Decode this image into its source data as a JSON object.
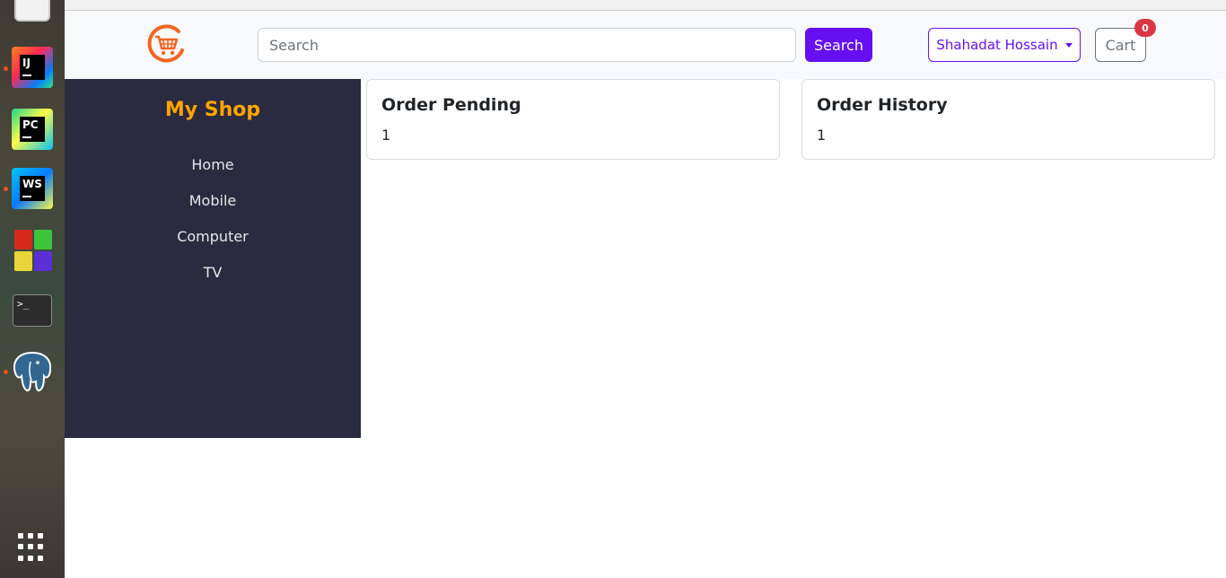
{
  "dock": {
    "items": [
      {
        "name": "intellij-idea",
        "label": "IJ"
      },
      {
        "name": "pycharm",
        "label": "PC"
      },
      {
        "name": "webstorm",
        "label": "WS"
      },
      {
        "name": "office-suite",
        "label": ""
      },
      {
        "name": "terminal",
        "label": ">_"
      },
      {
        "name": "pgadmin",
        "label": ""
      }
    ]
  },
  "navbar": {
    "logo_icon": "shopping-cart-icon",
    "search": {
      "placeholder": "Search",
      "value": ""
    },
    "search_button": "Search",
    "user_menu": "Shahadat Hossain",
    "cart_button": "Cart",
    "cart_count": "0"
  },
  "sidebar": {
    "brand": "My Shop",
    "links": [
      "Home",
      "Mobile",
      "Computer",
      "TV"
    ]
  },
  "cards": [
    {
      "title": "Order Pending",
      "value": "1"
    },
    {
      "title": "Order History",
      "value": "1"
    }
  ],
  "colors": {
    "primary": "#6610f2",
    "brand_orange": "#ffa500",
    "sidebar_bg": "#2a2a40",
    "badge_red": "#dc3545",
    "logo_orange": "#f26522"
  }
}
